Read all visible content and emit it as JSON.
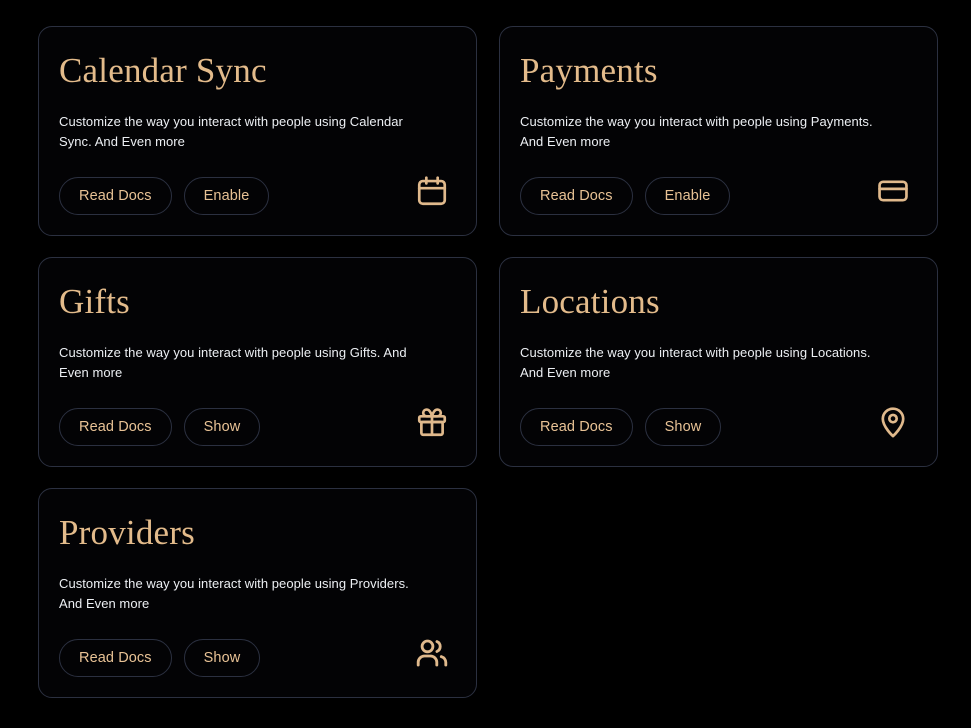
{
  "theme": {
    "page_background": "#000000",
    "card_background": "#030305",
    "card_border": "#2b3040",
    "accent": "#e3bb8b",
    "button_text": "#e8c295",
    "body_text": "#eceff3"
  },
  "cards": [
    {
      "title": "Calendar Sync",
      "description": "Customize the way you interact with people using Calendar Sync. And Even more",
      "primary_label": "Read Docs",
      "secondary_label": "Enable",
      "icon": "calendar-icon"
    },
    {
      "title": "Payments",
      "description": "Customize the way you interact with people using Payments. And Even more",
      "primary_label": "Read Docs",
      "secondary_label": "Enable",
      "icon": "credit-card-icon"
    },
    {
      "title": "Gifts",
      "description": "Customize the way you interact with people using Gifts. And Even more",
      "primary_label": "Read Docs",
      "secondary_label": "Show",
      "icon": "gift-icon"
    },
    {
      "title": "Locations",
      "description": "Customize the way you interact with people using Locations. And Even more",
      "primary_label": "Read Docs",
      "secondary_label": "Show",
      "icon": "map-pin-icon"
    },
    {
      "title": "Providers",
      "description": "Customize the way you interact with people using Providers. And Even more",
      "primary_label": "Read Docs",
      "secondary_label": "Show",
      "icon": "users-icon"
    }
  ]
}
